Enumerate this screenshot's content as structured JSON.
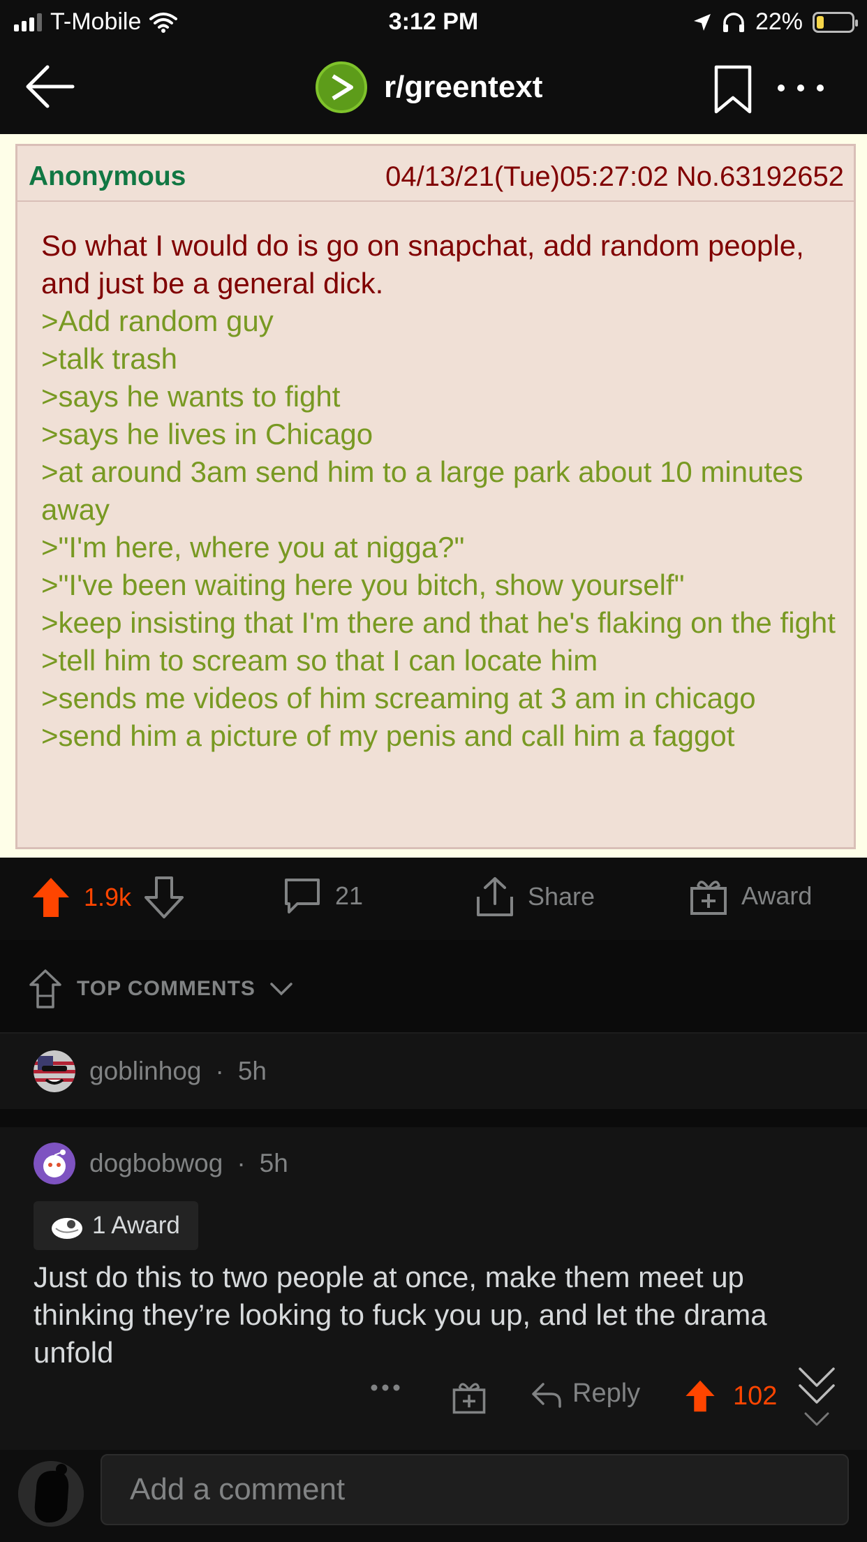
{
  "status_bar": {
    "carrier": "T-Mobile",
    "time": "3:12 PM",
    "battery": "22%"
  },
  "header": {
    "subreddit": "r/greentext",
    "icons": [
      "back-arrow-icon",
      "subreddit-icon",
      "bookmark-icon",
      "more-icon"
    ]
  },
  "post": {
    "greentext": {
      "name": "Anonymous",
      "meta": "04/13/21(Tue)05:27:02 No.63192652",
      "intro": "So what I would do is go on snapchat, add random people, and just be a general dick.",
      "lines": [
        ">Add random guy",
        ">talk trash",
        ">says he wants to fight",
        ">says he lives in Chicago",
        ">at around 3am send him to a large park about 10 minutes away",
        ">\"I'm here, where you at nigga?\"",
        ">\"I've been waiting here you bitch, show yourself\"",
        ">keep insisting that I'm there and that he's flaking on the fight",
        ">tell him to scream so that I can locate him",
        ">sends me videos of him screaming at 3 am in chicago",
        ">send him a picture of my penis and call him a faggot"
      ]
    },
    "actions": {
      "votes": "1.9k",
      "comments": "21",
      "share_label": "Share",
      "award_label": "Award"
    }
  },
  "sort": {
    "label": "TOP COMMENTS"
  },
  "comments": [
    {
      "author": "goblinhog",
      "age": "5h",
      "collapsed": true
    },
    {
      "author": "dogbobwog",
      "age": "5h",
      "award": "1 Award",
      "body": "Just do this to two people at once, make them meet up thinking they’re looking to fuck you up, and let the drama unfold",
      "reply_label": "Reply",
      "votes": "102"
    }
  ],
  "composer": {
    "placeholder": "Add a comment"
  },
  "colors": {
    "background": "#0b0b0b",
    "card": "#141414",
    "upvote": "#ff4500",
    "greentext": "#789922",
    "post_text": "#800000",
    "anon_name": "#117743",
    "post_bg": "#f0e0d6"
  }
}
